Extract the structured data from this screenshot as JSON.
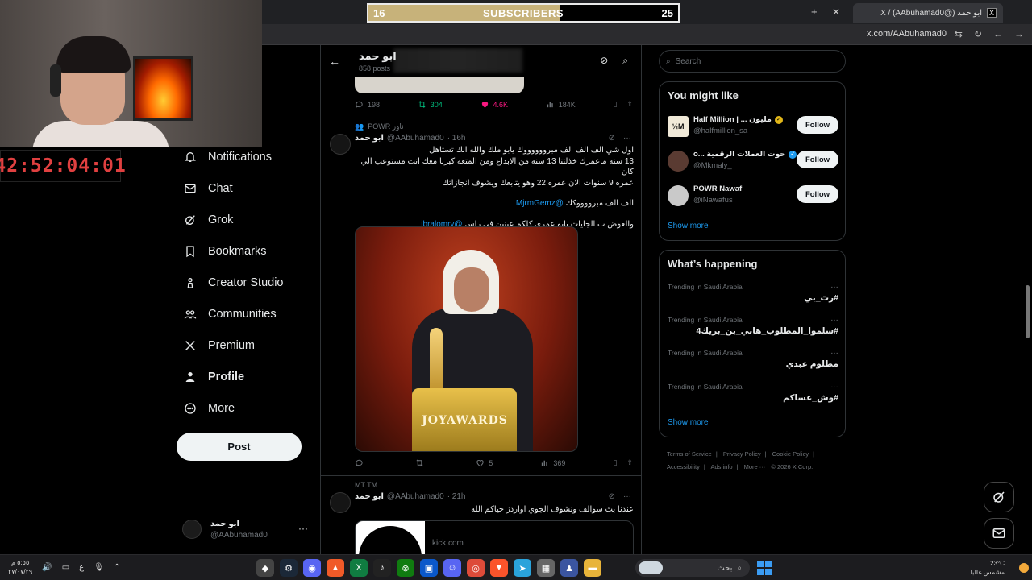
{
  "browser": {
    "tab_title": "X / (AAbuhamad0@) ابو حمد",
    "tab_logo": "X",
    "url": "x.com/AAbuhamad0"
  },
  "overlay": {
    "subs_start": "16",
    "subs_label": "SUBSCRIBERS",
    "subs_end": "25",
    "subs_progress_percent": 62,
    "timer": "42:52:04:01"
  },
  "nav": {
    "items": [
      {
        "label": "Notifications",
        "icon": "bell-icon"
      },
      {
        "label": "Chat",
        "icon": "mail-icon"
      },
      {
        "label": "Grok",
        "icon": "grok-icon"
      },
      {
        "label": "Bookmarks",
        "icon": "bookmark-icon"
      },
      {
        "label": "Creator Studio",
        "icon": "creator-icon"
      },
      {
        "label": "Communities",
        "icon": "people-icon"
      },
      {
        "label": "Premium",
        "icon": "x-logo-icon"
      },
      {
        "label": "Profile",
        "icon": "person-icon"
      },
      {
        "label": "More",
        "icon": "more-circle-icon"
      }
    ],
    "post_label": "Post",
    "account": {
      "name": "ابو حمد",
      "handle": "@AAbuhamad0",
      "more": "···"
    }
  },
  "header": {
    "name": "ابو حمد",
    "posts": "858 posts"
  },
  "prev_tweet_actions": {
    "replies": "198",
    "reposts": "304",
    "likes": "4.6K",
    "views": "184K"
  },
  "tweet1": {
    "context": "POWR ناور",
    "name": "ابو حمد",
    "handle": "@AAbuhamad0",
    "time": "· 16h",
    "line1": "اول شي الف الف الف مبرووووووك يابو ملك والله انك تستاهل",
    "line2": "13 سنه ماعمرك خذلتنا 13 سنه من الابداع ومن المتعه كبرنا معك انت مستوعب الي كان",
    "line3": "عمره 9 سنوات الان عمره 22 وهو يتابعك ويشوف انجازاتك",
    "line4_text": "الف الف مبرووووكك",
    "line4_mention": "@MjrmGemz",
    "line5_text": "والعوض ب الجايات يابو عمري كلكم عينين في راس",
    "line5_mention": "@ibralomry",
    "image_caption": "JOYAWARDS",
    "actions": {
      "replies": "",
      "reposts": "",
      "likes": "5",
      "views": "369"
    }
  },
  "tweet2": {
    "context": "MT TM",
    "name": "ابو حمد",
    "handle": "@AAbuhamad0",
    "time": "· 21h",
    "text": "عندنا بث سوالف ونشوف الجوي اواردز حياكم الله",
    "card_domain": "kick.com"
  },
  "sidebar": {
    "search_placeholder": "Search",
    "you_might_like": {
      "title": "You might like",
      "accounts": [
        {
          "name": "Half Million | ... مليون",
          "handle": "@halfmillion_sa",
          "avatar_text": "½M",
          "badge_color": "#e2b719",
          "follow": "Follow"
        },
        {
          "name": "o... حوت العملات الرقمية",
          "handle": "@Mkmaly_",
          "avatar_text": "",
          "badge_color": "#1d9bf0",
          "follow": "Follow"
        },
        {
          "name": "POWR Nawaf",
          "handle": "@iNawafus",
          "avatar_text": "",
          "badge_color": "",
          "follow": "Follow"
        }
      ],
      "show_more": "Show more"
    },
    "whats_happening": {
      "title": "What’s happening",
      "trends": [
        {
          "context": "Trending in Saudi Arabia",
          "name": "#رث_بي"
        },
        {
          "context": "Trending in Saudi Arabia",
          "name": "#سلموا_المطلوب_هاني_بن_بريك4"
        },
        {
          "context": "Trending in Saudi Arabia",
          "name": "مظلوم عبدي"
        },
        {
          "context": "Trending in Saudi Arabia",
          "name": "#وش_عساكم"
        }
      ],
      "show_more": "Show more"
    },
    "footer": [
      "Terms of Service",
      "|",
      "Privacy Policy",
      "|",
      "Cookie Policy",
      "|",
      "Accessibility",
      "|",
      "Ads info",
      "|",
      "More ···",
      "© 2026 X Corp."
    ]
  },
  "taskbar": {
    "time": "٥:٥٥ م",
    "date": "٢٧/٠٧/٢٩",
    "lang": "ع",
    "search_text": "بحث",
    "weather_temp": "23°C",
    "weather_desc": "مشمس غالبا"
  },
  "colors": {
    "accent": "#1d9bf0",
    "like": "#f91880",
    "repost": "#00ba7c",
    "bg": "#000000",
    "timer": "#e04040"
  }
}
